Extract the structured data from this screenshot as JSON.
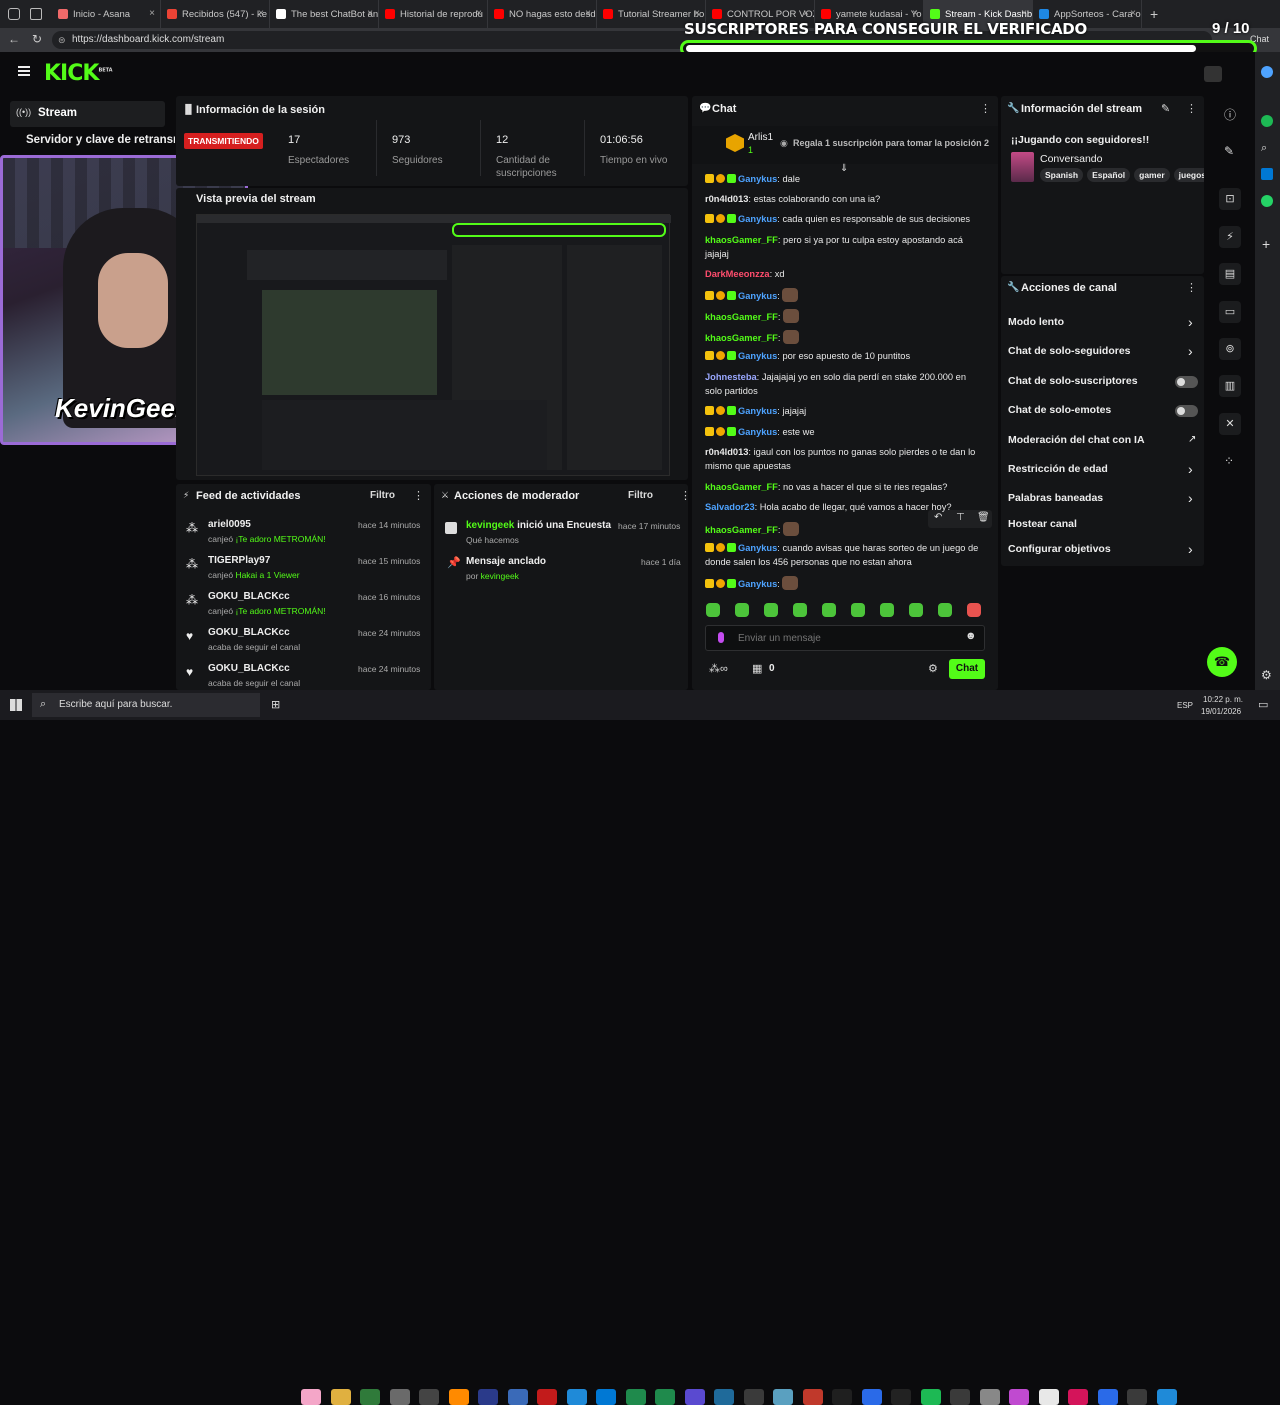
{
  "browser": {
    "tabs": [
      {
        "label": "Inicio - Asana",
        "color": "#f06a6a"
      },
      {
        "label": "Recibidos (547) - ke",
        "color": "#ea4335"
      },
      {
        "label": "The best ChatBot an",
        "color": "#ffffff"
      },
      {
        "label": "Historial de reprodu",
        "color": "#ff0000"
      },
      {
        "label": "NO hagas esto desd",
        "color": "#ff0000"
      },
      {
        "label": "Tutorial Streamer bo",
        "color": "#ff0000"
      },
      {
        "label": "CONTROL POR VOZ",
        "color": "#ff0000"
      },
      {
        "label": "yamete kudasai - Yo",
        "color": "#ff0000"
      },
      {
        "label": "Stream - Kick Dashb",
        "color": "#53fc18"
      },
      {
        "label": "AppSorteos - Cara o",
        "color": "#1e88e5"
      }
    ],
    "url": "https://dashboard.kick.com/stream",
    "chat_label": "Chat"
  },
  "overlay": {
    "title": "SUSCRIPTORES PARA CONSEGUIR EL VERIFICADO",
    "progress_text": "9 / 10",
    "progress": 0.9
  },
  "kick": {
    "logo": "KICK",
    "logo_sup": "BETA"
  },
  "sidebar": {
    "stream_label": "Stream",
    "server_key_label": "Servidor y clave de retransmisión",
    "streamer_overlay": "KevinGeek"
  },
  "session": {
    "title": "Información de la sesión",
    "live_badge": "TRANSMITIENDO",
    "stats": [
      {
        "value": "17",
        "label": "Espectadores"
      },
      {
        "value": "973",
        "label": "Seguidores"
      },
      {
        "value": "12",
        "label": "Cantidad de suscripciones"
      },
      {
        "value": "01:06:56",
        "label": "Tiempo en vivo"
      }
    ],
    "preview_title": "Vista previa del stream"
  },
  "feed": {
    "title": "Feed de actividades",
    "filter": "Filtro",
    "items": [
      {
        "name": "ariel0095",
        "action": "canjeó",
        "reward": "¡Te adoro METROMÁN!",
        "time": "hace 14 minutos",
        "icon": "dots"
      },
      {
        "name": "TIGERPlay97",
        "action": "canjeó",
        "reward": "Hakai a 1 Viewer",
        "time": "hace 15 minutos",
        "icon": "dots"
      },
      {
        "name": "GOKU_BLACKcc",
        "action": "canjeó",
        "reward": "¡Te adoro METROMÁN!",
        "time": "hace 16 minutos",
        "icon": "dots"
      },
      {
        "name": "GOKU_BLACKcc",
        "action": "acaba de seguir el canal",
        "reward": "",
        "time": "hace 24 minutos",
        "icon": "heart"
      },
      {
        "name": "GOKU_BLACKcc",
        "action": "acaba de seguir el canal",
        "reward": "",
        "time": "hace 24 minutos",
        "icon": "heart"
      }
    ]
  },
  "mod": {
    "title": "Acciones de moderador",
    "filter": "Filtro",
    "items": [
      {
        "user": "kevingeek",
        "text": " inició una Encuesta",
        "sub": "Qué hacemos",
        "time": "hace 17 minutos"
      },
      {
        "user": "",
        "text": "Mensaje anclado",
        "sub_prefix": "por ",
        "sub": "kevingeek",
        "time": "hace 1 día"
      }
    ]
  },
  "chat": {
    "title": "Chat",
    "top_user": "Arlis1",
    "top_count": "1",
    "gift_text": "Regala 1 suscripción para tomar la posición 2",
    "messages": [
      {
        "user": "Ganykus",
        "text": "dale",
        "color": "#4ea3ff",
        "badges": true
      },
      {
        "user": "r0n4ld013",
        "text": "estas colaborando con una ia?",
        "color": "#e8e8e8",
        "badges": false
      },
      {
        "user": "Ganykus",
        "text": "cada quien es responsable de sus decisiones",
        "color": "#4ea3ff",
        "badges": true
      },
      {
        "user": "khaosGamer_FF",
        "text": "pero si ya por tu culpa estoy apostando acá jajajaj",
        "color": "#53fc18",
        "badges": false
      },
      {
        "user": "DarkMeeonzza",
        "text": "xd",
        "color": "#ff4d6d",
        "badges": false
      },
      {
        "user": "Ganykus",
        "text": "",
        "color": "#4ea3ff",
        "badges": true,
        "emote": true
      },
      {
        "user": "khaosGamer_FF",
        "text": "",
        "color": "#53fc18",
        "badges": false,
        "emote": true
      },
      {
        "user": "khaosGamer_FF",
        "text": "",
        "color": "#53fc18",
        "badges": false,
        "emote": true
      },
      {
        "user": "Ganykus",
        "text": "por eso apuesto de 10 puntitos",
        "color": "#4ea3ff",
        "badges": true
      },
      {
        "user": "Johnesteba",
        "text": "Jajajajaj yo en solo dia perdí en stake 200.000 en solo partidos",
        "color": "#9aa8ff",
        "badges": false
      },
      {
        "user": "Ganykus",
        "text": "jajajaj",
        "color": "#4ea3ff",
        "badges": true
      },
      {
        "user": "Ganykus",
        "text": "este we",
        "color": "#4ea3ff",
        "badges": true
      },
      {
        "user": "r0n4ld013",
        "text": "igaul con los puntos no ganas solo pierdes o te dan lo mismo que apuestas",
        "color": "#e8e8e8",
        "badges": false
      },
      {
        "user": "khaosGamer_FF",
        "text": "no vas a hacer el que si te ries regalas?",
        "color": "#53fc18",
        "badges": false
      },
      {
        "user": "Salvador23",
        "text": "Hola acabo de llegar, qué vamos a hacer hoy?",
        "color": "#4ea3ff",
        "badges": false
      },
      {
        "user": "khaosGamer_FF",
        "text": "",
        "color": "#53fc18",
        "badges": false,
        "emote": true
      },
      {
        "user": "Ganykus",
        "text": "cuando avisas que haras sorteo de un juego de donde salen los 456 personas que no estan ahora",
        "color": "#4ea3ff",
        "badges": true
      },
      {
        "user": "Ganykus",
        "text": "",
        "color": "#4ea3ff",
        "badges": true,
        "emote": true
      }
    ],
    "input_placeholder": "Enviar un mensaje",
    "points": "0",
    "send_label": "Chat"
  },
  "stream_info": {
    "title": "Información del stream",
    "stream_title": "¡¡Jugando con seguidores!!",
    "category": "Conversando",
    "tags": [
      "Spanish",
      "Español",
      "gamer",
      "juegos"
    ]
  },
  "channel_actions": {
    "title": "Acciones de canal",
    "items": [
      {
        "label": "Modo lento",
        "control": "chevron"
      },
      {
        "label": "Chat de solo-seguidores",
        "control": "chevron"
      },
      {
        "label": "Chat de solo-suscriptores",
        "control": "toggle"
      },
      {
        "label": "Chat de solo-emotes",
        "control": "toggle"
      },
      {
        "label": "Moderación del chat con IA",
        "control": "external"
      },
      {
        "label": "Restricción de edad",
        "control": "chevron"
      },
      {
        "label": "Palabras baneadas",
        "control": "chevron"
      },
      {
        "label": "Hostear canal",
        "control": "none"
      },
      {
        "label": "Configurar objetivos",
        "control": "chevron"
      }
    ]
  },
  "taskbar": {
    "search_placeholder": "Escribe aquí para buscar.",
    "lang": "ESP",
    "time": "10:22 p. m.",
    "date": "19/01/2026"
  }
}
